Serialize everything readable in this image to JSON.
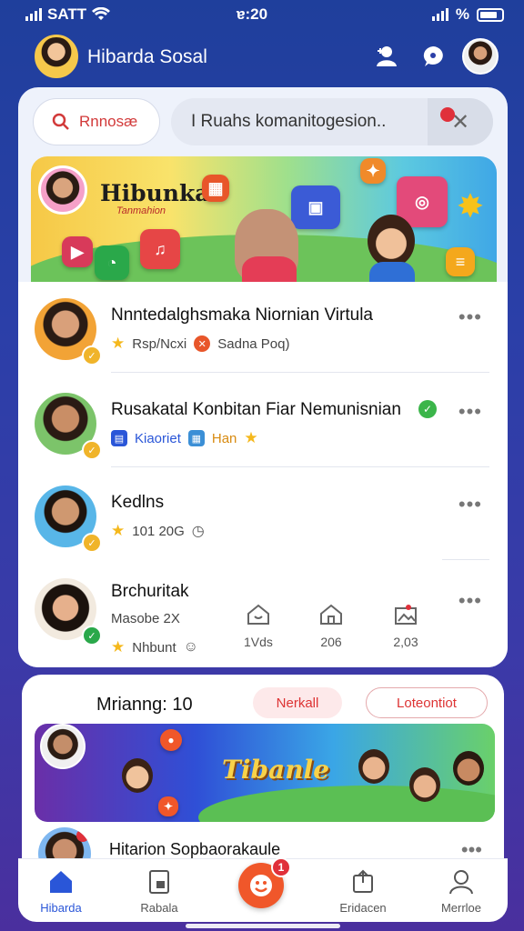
{
  "status": {
    "carrier": "SATT",
    "time": "ɐ:20",
    "battery_label": "%"
  },
  "header": {
    "title": "Hibarda Sosal"
  },
  "search": {
    "left_label": "Rnnosæ",
    "right_text": "I Ruahs komanitogesion..",
    "badge": "x"
  },
  "banner": {
    "brand": "Hibunka",
    "subtitle": "Tanmahion"
  },
  "list": [
    {
      "name": "Nnntedalghsmaka Niornian Virtula",
      "sub1": "Rsp/Ncxi",
      "sub2": "Sadna Poq)",
      "badge_color": "#f0b42a"
    },
    {
      "name": "Rusakatal Konbitan Fiar Nemunisnian",
      "sub1": "Kiaoriet",
      "sub2": "Han",
      "badge_color": "#f0b42a"
    },
    {
      "name": "Kedlns",
      "sub1": "101 20G",
      "badge_color": "#f0b42a"
    },
    {
      "name": "Brchuritak",
      "sub1": "Masobe 2X",
      "sub2": "Nhbunt",
      "badge_color": "#2aa84a",
      "stats": [
        {
          "value": "1Vds"
        },
        {
          "value": "206"
        },
        {
          "value": "2,03"
        }
      ]
    }
  ],
  "feed": {
    "label": "Mrianng: 10",
    "button1": "Nerkall",
    "button2": "Loteontiot",
    "banner_word": "Tibanle",
    "row_name": "Hitarion Sopbaorakaule"
  },
  "tabs": [
    {
      "label": "Hibarda",
      "active": true
    },
    {
      "label": "Rabala"
    },
    {
      "label": "Eridacen"
    },
    {
      "label": "Merrloe"
    }
  ],
  "fab_count": "1",
  "colors": {
    "accent": "#2a56d8",
    "alert": "#e0303a",
    "brand_orange": "#f0572a"
  }
}
